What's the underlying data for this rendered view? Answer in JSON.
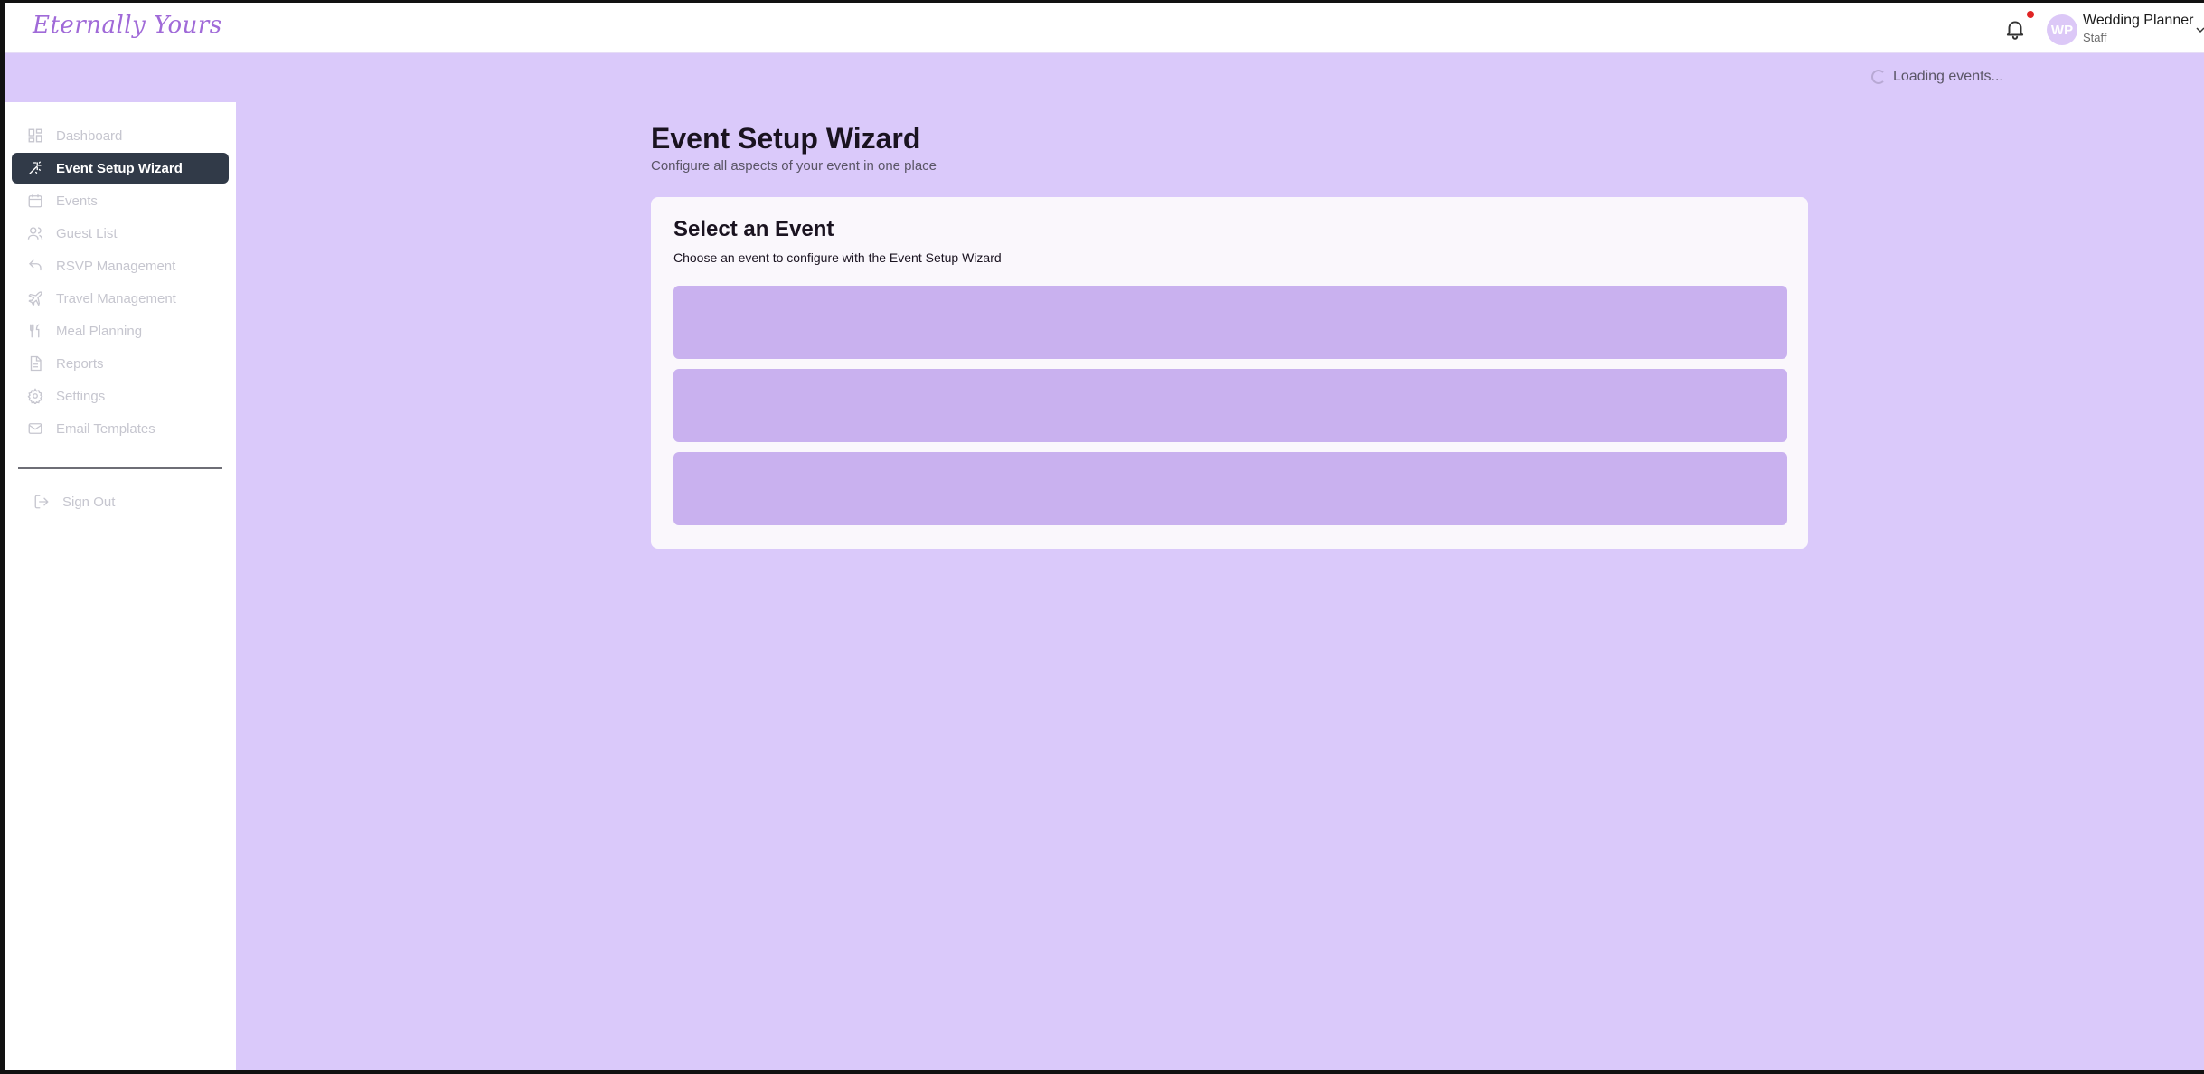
{
  "header": {
    "logo": "Eternally Yours",
    "user_initials": "WP",
    "user_name": "Wedding Planner",
    "user_role": "Staff",
    "notification_dot_color": "#e02424"
  },
  "status": {
    "loading_text": "Loading events..."
  },
  "sidebar": {
    "items": [
      {
        "label": "Dashboard",
        "icon": "dashboard-icon",
        "active": false
      },
      {
        "label": "Event Setup Wizard",
        "icon": "wand-icon",
        "active": true
      },
      {
        "label": "Events",
        "icon": "calendar-icon",
        "active": false
      },
      {
        "label": "Guest List",
        "icon": "users-icon",
        "active": false
      },
      {
        "label": "RSVP Management",
        "icon": "reply-icon",
        "active": false
      },
      {
        "label": "Travel Management",
        "icon": "plane-icon",
        "active": false
      },
      {
        "label": "Meal Planning",
        "icon": "utensils-icon",
        "active": false
      },
      {
        "label": "Reports",
        "icon": "file-icon",
        "active": false
      },
      {
        "label": "Settings",
        "icon": "gear-icon",
        "active": false
      },
      {
        "label": "Email Templates",
        "icon": "mail-icon",
        "active": false
      }
    ],
    "sign_out": "Sign Out"
  },
  "main": {
    "title": "Event Setup Wizard",
    "subtitle": "Configure all aspects of your event in one place",
    "card": {
      "title": "Select an Event",
      "description": "Choose an event to configure with the Event Setup Wizard",
      "skeleton_count": 3
    }
  },
  "colors": {
    "background": "#dac9fa",
    "active_nav": "#313a48",
    "skeleton": "#c9b1ef",
    "brand": "#a06ad8"
  }
}
